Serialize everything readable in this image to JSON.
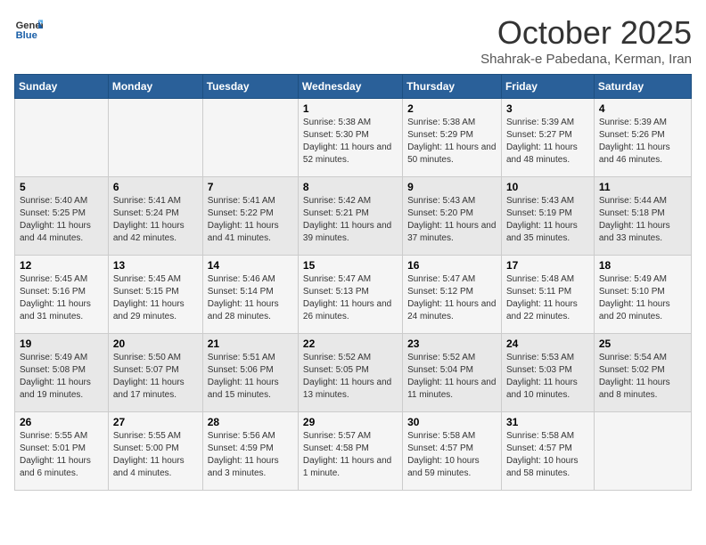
{
  "header": {
    "logo_general": "General",
    "logo_blue": "Blue",
    "month_title": "October 2025",
    "subtitle": "Shahrak-e Pabedana, Kerman, Iran"
  },
  "weekdays": [
    "Sunday",
    "Monday",
    "Tuesday",
    "Wednesday",
    "Thursday",
    "Friday",
    "Saturday"
  ],
  "weeks": [
    [
      {
        "day": "",
        "info": ""
      },
      {
        "day": "",
        "info": ""
      },
      {
        "day": "",
        "info": ""
      },
      {
        "day": "1",
        "info": "Sunrise: 5:38 AM\nSunset: 5:30 PM\nDaylight: 11 hours and 52 minutes."
      },
      {
        "day": "2",
        "info": "Sunrise: 5:38 AM\nSunset: 5:29 PM\nDaylight: 11 hours and 50 minutes."
      },
      {
        "day": "3",
        "info": "Sunrise: 5:39 AM\nSunset: 5:27 PM\nDaylight: 11 hours and 48 minutes."
      },
      {
        "day": "4",
        "info": "Sunrise: 5:39 AM\nSunset: 5:26 PM\nDaylight: 11 hours and 46 minutes."
      }
    ],
    [
      {
        "day": "5",
        "info": "Sunrise: 5:40 AM\nSunset: 5:25 PM\nDaylight: 11 hours and 44 minutes."
      },
      {
        "day": "6",
        "info": "Sunrise: 5:41 AM\nSunset: 5:24 PM\nDaylight: 11 hours and 42 minutes."
      },
      {
        "day": "7",
        "info": "Sunrise: 5:41 AM\nSunset: 5:22 PM\nDaylight: 11 hours and 41 minutes."
      },
      {
        "day": "8",
        "info": "Sunrise: 5:42 AM\nSunset: 5:21 PM\nDaylight: 11 hours and 39 minutes."
      },
      {
        "day": "9",
        "info": "Sunrise: 5:43 AM\nSunset: 5:20 PM\nDaylight: 11 hours and 37 minutes."
      },
      {
        "day": "10",
        "info": "Sunrise: 5:43 AM\nSunset: 5:19 PM\nDaylight: 11 hours and 35 minutes."
      },
      {
        "day": "11",
        "info": "Sunrise: 5:44 AM\nSunset: 5:18 PM\nDaylight: 11 hours and 33 minutes."
      }
    ],
    [
      {
        "day": "12",
        "info": "Sunrise: 5:45 AM\nSunset: 5:16 PM\nDaylight: 11 hours and 31 minutes."
      },
      {
        "day": "13",
        "info": "Sunrise: 5:45 AM\nSunset: 5:15 PM\nDaylight: 11 hours and 29 minutes."
      },
      {
        "day": "14",
        "info": "Sunrise: 5:46 AM\nSunset: 5:14 PM\nDaylight: 11 hours and 28 minutes."
      },
      {
        "day": "15",
        "info": "Sunrise: 5:47 AM\nSunset: 5:13 PM\nDaylight: 11 hours and 26 minutes."
      },
      {
        "day": "16",
        "info": "Sunrise: 5:47 AM\nSunset: 5:12 PM\nDaylight: 11 hours and 24 minutes."
      },
      {
        "day": "17",
        "info": "Sunrise: 5:48 AM\nSunset: 5:11 PM\nDaylight: 11 hours and 22 minutes."
      },
      {
        "day": "18",
        "info": "Sunrise: 5:49 AM\nSunset: 5:10 PM\nDaylight: 11 hours and 20 minutes."
      }
    ],
    [
      {
        "day": "19",
        "info": "Sunrise: 5:49 AM\nSunset: 5:08 PM\nDaylight: 11 hours and 19 minutes."
      },
      {
        "day": "20",
        "info": "Sunrise: 5:50 AM\nSunset: 5:07 PM\nDaylight: 11 hours and 17 minutes."
      },
      {
        "day": "21",
        "info": "Sunrise: 5:51 AM\nSunset: 5:06 PM\nDaylight: 11 hours and 15 minutes."
      },
      {
        "day": "22",
        "info": "Sunrise: 5:52 AM\nSunset: 5:05 PM\nDaylight: 11 hours and 13 minutes."
      },
      {
        "day": "23",
        "info": "Sunrise: 5:52 AM\nSunset: 5:04 PM\nDaylight: 11 hours and 11 minutes."
      },
      {
        "day": "24",
        "info": "Sunrise: 5:53 AM\nSunset: 5:03 PM\nDaylight: 11 hours and 10 minutes."
      },
      {
        "day": "25",
        "info": "Sunrise: 5:54 AM\nSunset: 5:02 PM\nDaylight: 11 hours and 8 minutes."
      }
    ],
    [
      {
        "day": "26",
        "info": "Sunrise: 5:55 AM\nSunset: 5:01 PM\nDaylight: 11 hours and 6 minutes."
      },
      {
        "day": "27",
        "info": "Sunrise: 5:55 AM\nSunset: 5:00 PM\nDaylight: 11 hours and 4 minutes."
      },
      {
        "day": "28",
        "info": "Sunrise: 5:56 AM\nSunset: 4:59 PM\nDaylight: 11 hours and 3 minutes."
      },
      {
        "day": "29",
        "info": "Sunrise: 5:57 AM\nSunset: 4:58 PM\nDaylight: 11 hours and 1 minute."
      },
      {
        "day": "30",
        "info": "Sunrise: 5:58 AM\nSunset: 4:57 PM\nDaylight: 10 hours and 59 minutes."
      },
      {
        "day": "31",
        "info": "Sunrise: 5:58 AM\nSunset: 4:57 PM\nDaylight: 10 hours and 58 minutes."
      },
      {
        "day": "",
        "info": ""
      }
    ]
  ]
}
